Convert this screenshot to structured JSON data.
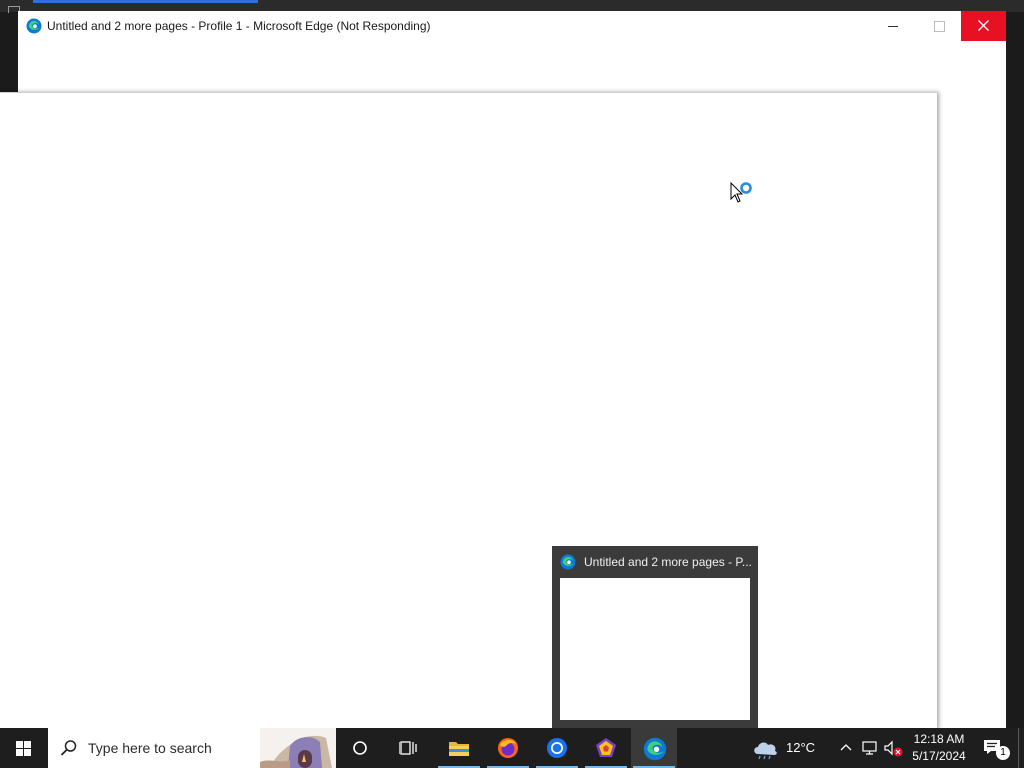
{
  "window": {
    "title": "Untitled and 2 more pages - Profile 1 - Microsoft Edge (Not Responding)",
    "app_icon": "edge-icon",
    "controls": [
      "minimize-icon",
      "maximize-icon",
      "close-icon"
    ],
    "close_color": "#e81123"
  },
  "preview": {
    "title": "Untitled and 2 more pages - P...",
    "icon": "edge-icon"
  },
  "taskbar": {
    "search_placeholder": "Type here to search",
    "apps": [
      "file-explorer-icon",
      "firefox-icon",
      "chrome-icon",
      "app-icon",
      "edge-icon"
    ],
    "weather": {
      "temp": "12°C",
      "icon": "cloud-rain-icon"
    },
    "clock": {
      "time": "12:18 AM",
      "date": "5/17/2024"
    },
    "notifications": {
      "count": "1"
    }
  },
  "cursor": {
    "icon": "busy-cursor-icon"
  },
  "colors": {
    "taskbar": "#1e1e1e",
    "accent": "#76b9ed"
  }
}
